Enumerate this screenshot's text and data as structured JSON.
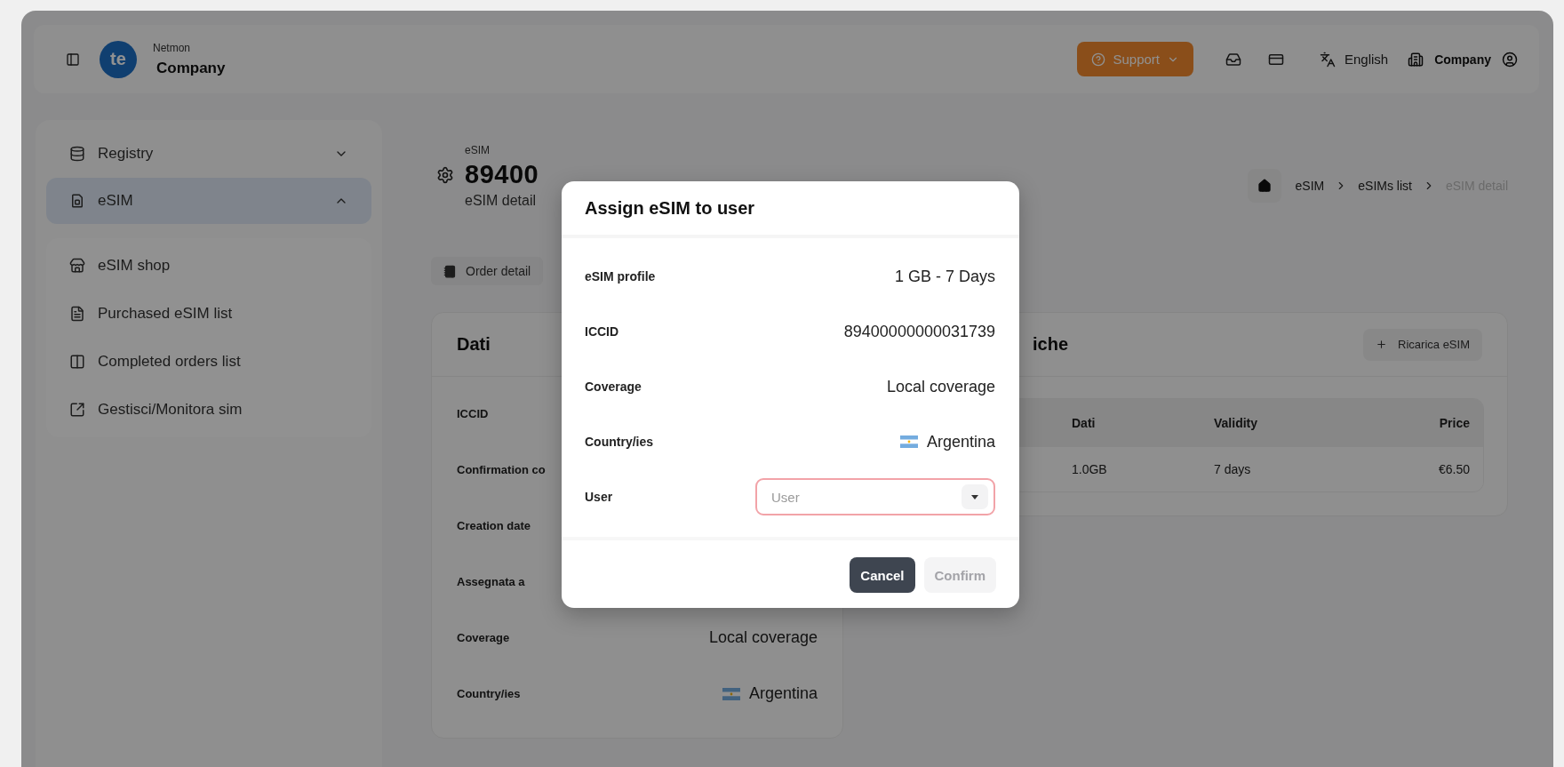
{
  "topbar": {
    "logo_text": "te",
    "brand_small": "Netmon",
    "brand": "Company",
    "support": "Support",
    "language": "English",
    "account": "Company"
  },
  "sidebar": {
    "items": [
      {
        "label": "Registry",
        "expanded": false,
        "selected": false
      },
      {
        "label": "eSIM",
        "expanded": true,
        "selected": true,
        "children": [
          "eSIM shop",
          "Purchased eSIM list",
          "Completed orders list",
          "Gestisci/Monitora sim"
        ]
      }
    ]
  },
  "page": {
    "overline": "eSIM",
    "title": "89400",
    "subtitle": "eSIM detail",
    "breadcrumb": [
      {
        "label": "eSIM",
        "current": false
      },
      {
        "label": "eSIMs list",
        "current": false
      },
      {
        "label": "eSIM detail",
        "current": true
      }
    ],
    "order_button": "Order detail"
  },
  "data_card": {
    "title": "Dati",
    "rows": [
      {
        "kind": "text",
        "label": "ICCID"
      },
      {
        "kind": "text",
        "label": "Confirmation co"
      },
      {
        "kind": "text",
        "label": "Creation date"
      },
      {
        "kind": "text",
        "label": "Assegnata a"
      },
      {
        "kind": "text",
        "label": "Coverage",
        "value": "Local coverage"
      },
      {
        "kind": "country",
        "label": "Country/ies",
        "value": "Argentina"
      }
    ]
  },
  "recharges_card": {
    "title": "iche",
    "button": "Ricarica eSIM",
    "columns": [
      "Dati",
      "Validity",
      "Price"
    ],
    "rows": [
      [
        "1.0GB",
        "7 days",
        "€6.50"
      ]
    ]
  },
  "modal": {
    "title": "Assign eSIM to user",
    "rows": [
      {
        "kind": "text",
        "label": "eSIM profile",
        "value": "1 GB - 7 Days"
      },
      {
        "kind": "text",
        "label": "ICCID",
        "value": "89400000000031739"
      },
      {
        "kind": "text",
        "label": "Coverage",
        "value": "Local coverage"
      },
      {
        "kind": "country",
        "label": "Country/ies",
        "value": "Argentina"
      },
      {
        "kind": "select",
        "label": "User",
        "placeholder": "User",
        "invalid": true
      }
    ],
    "buttons": [
      {
        "label": "Cancel",
        "kind": "secondary",
        "disabled": false
      },
      {
        "label": "Confirm",
        "kind": "primary",
        "disabled": true
      }
    ]
  }
}
